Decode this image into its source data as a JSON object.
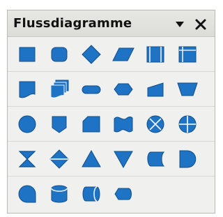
{
  "panel": {
    "title": "Flussdiagramme",
    "menu_icon": "dropdown-arrow-icon",
    "close_icon": "close-icon"
  },
  "shape_color": "#1f73c4",
  "shape_rows": [
    [
      "process",
      "alternate-process",
      "decision",
      "data",
      "predefined-process",
      "internal-storage"
    ],
    [
      "document",
      "multidocument",
      "terminator",
      "preparation",
      "manual-input",
      "manual-operation"
    ],
    [
      "connector",
      "off-page-connector",
      "card",
      "punched-tape",
      "summing-junction",
      "or"
    ],
    [
      "collate",
      "sort",
      "extract",
      "merge",
      "stored-data",
      "delay"
    ],
    [
      "sequential-access",
      "magnetic-disk",
      "direct-access-storage",
      "display"
    ]
  ]
}
